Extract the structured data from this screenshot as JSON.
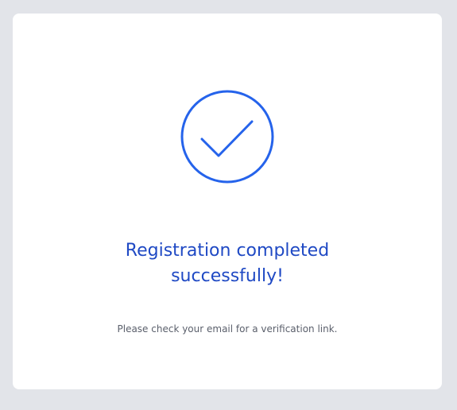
{
  "success_card": {
    "icon": "checkmark-circle-icon",
    "accent_color": "#2563eb",
    "title_lines": [
      "Registration completed",
      "successfully!"
    ],
    "message": "Please check your email for a verification link."
  }
}
